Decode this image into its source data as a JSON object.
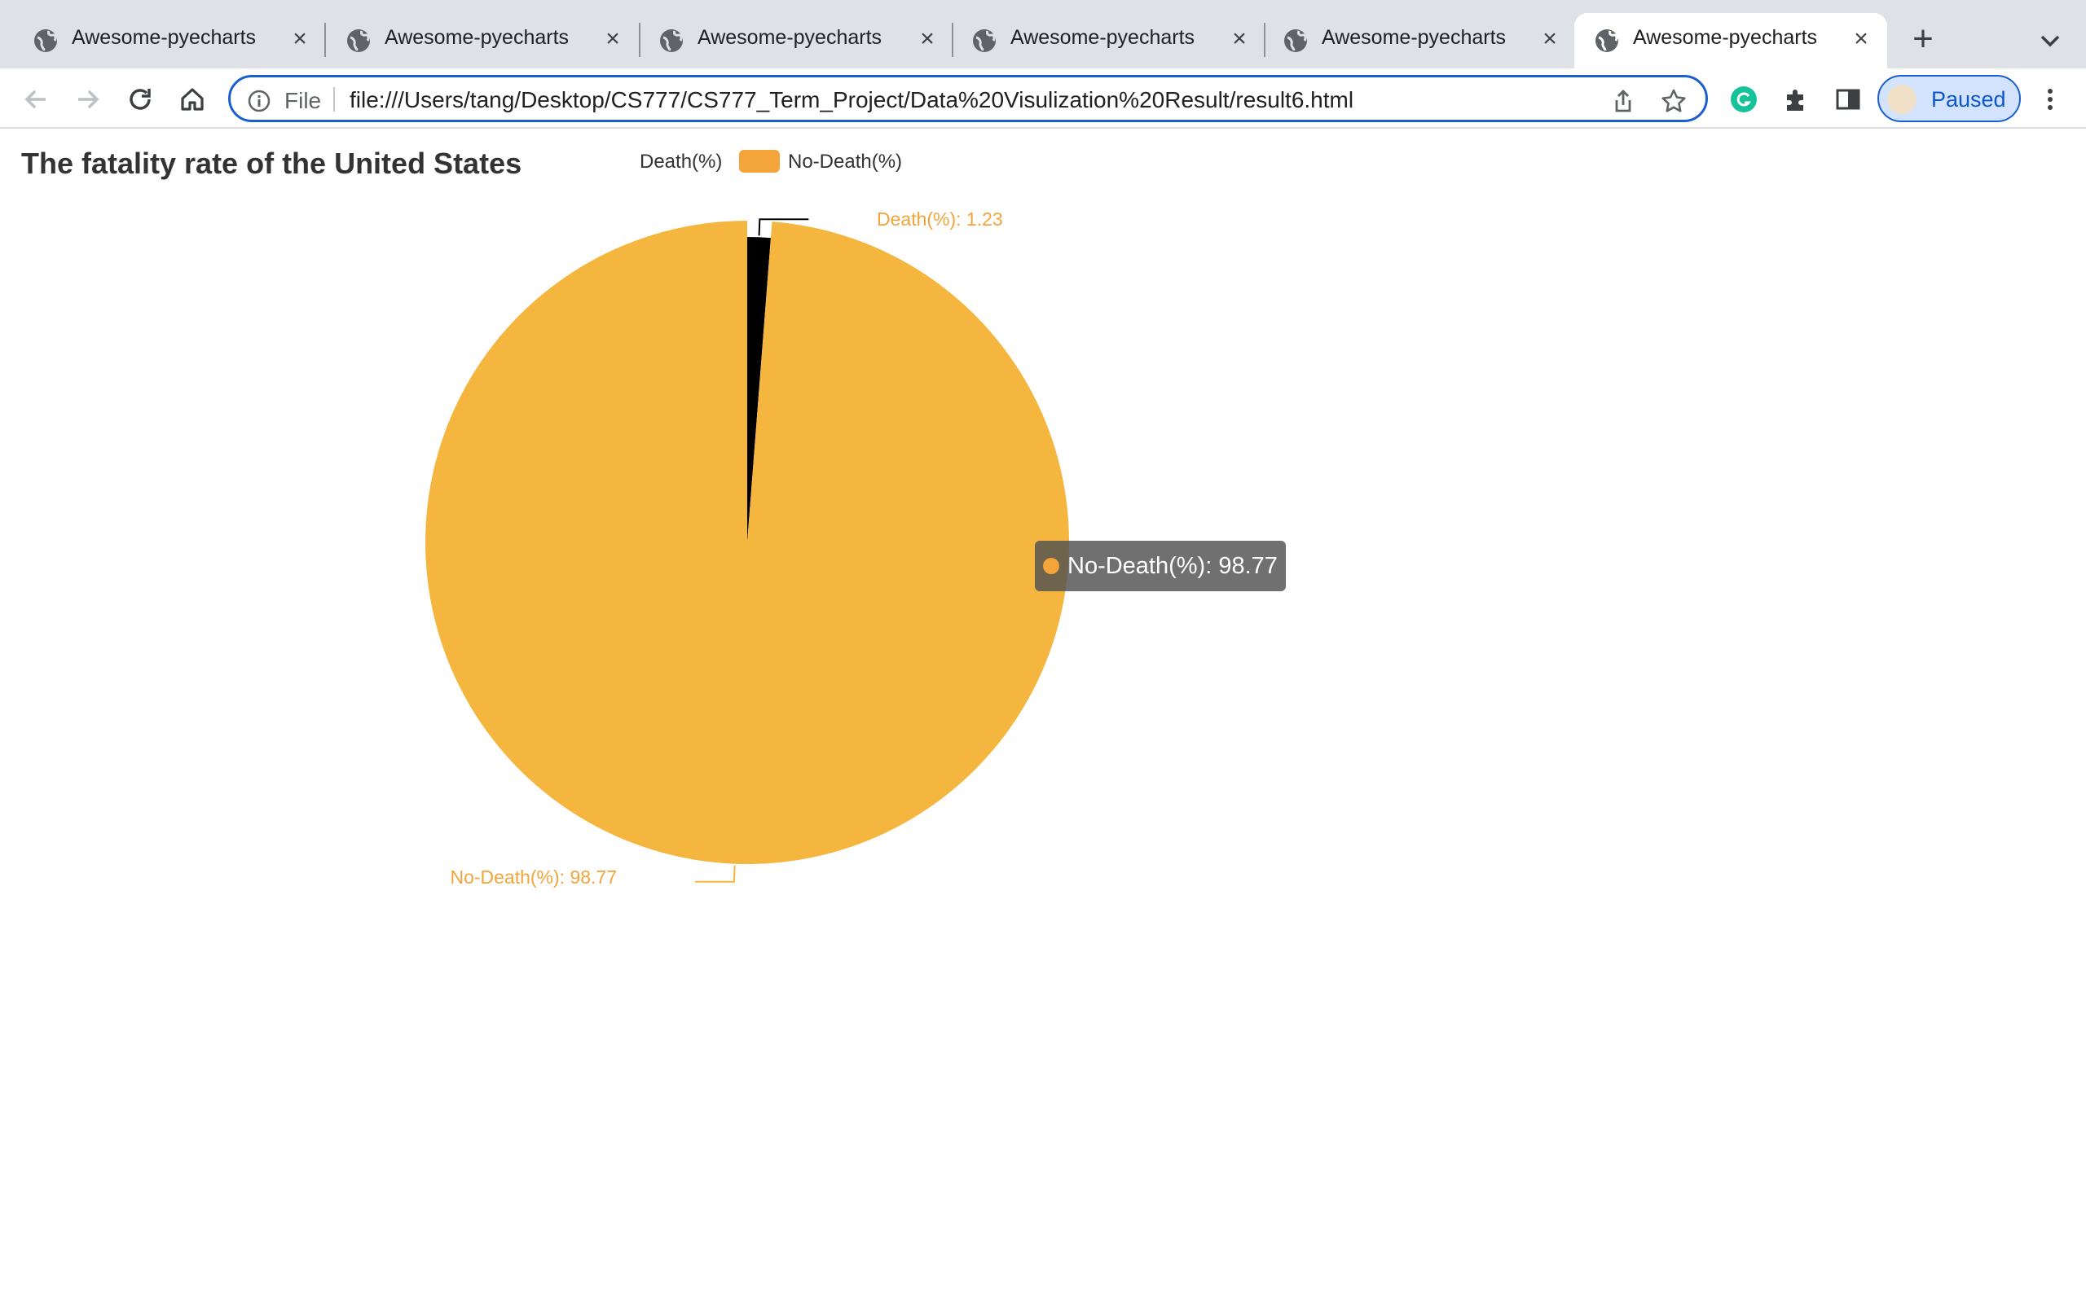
{
  "browser": {
    "tabs": [
      {
        "title": "Awesome-pyecharts",
        "active": false
      },
      {
        "title": "Awesome-pyecharts",
        "active": false
      },
      {
        "title": "Awesome-pyecharts",
        "active": false
      },
      {
        "title": "Awesome-pyecharts",
        "active": false
      },
      {
        "title": "Awesome-pyecharts",
        "active": false
      },
      {
        "title": "Awesome-pyecharts",
        "active": true
      }
    ],
    "new_tab_icon": "plus-icon",
    "tab_close_icon": "close-icon",
    "address": {
      "scheme_label": "File",
      "url": "file:///Users/tang/Desktop/CS777/CS777_Term_Project/Data%20Visulization%20Result/result6.html"
    },
    "profile": {
      "label": "Paused"
    }
  },
  "chart_data": {
    "type": "pie",
    "title": "The fatality rate of the United States",
    "legend_position": "top-center",
    "categories": [
      "Death(%)",
      "No-Death(%)"
    ],
    "values": [
      1.23,
      98.77
    ],
    "colors": [
      "#000000",
      "#f5b640"
    ],
    "legend_colors": [
      "#000000",
      "#f3a43b"
    ],
    "legend": [
      "Death(%)",
      "No-Death(%)"
    ],
    "slice_labels": [
      "Death(%): 1.23",
      "No-Death(%): 98.77"
    ],
    "tooltip": {
      "text": "No-Death(%): 98.77",
      "color": "#f3a43b"
    }
  }
}
